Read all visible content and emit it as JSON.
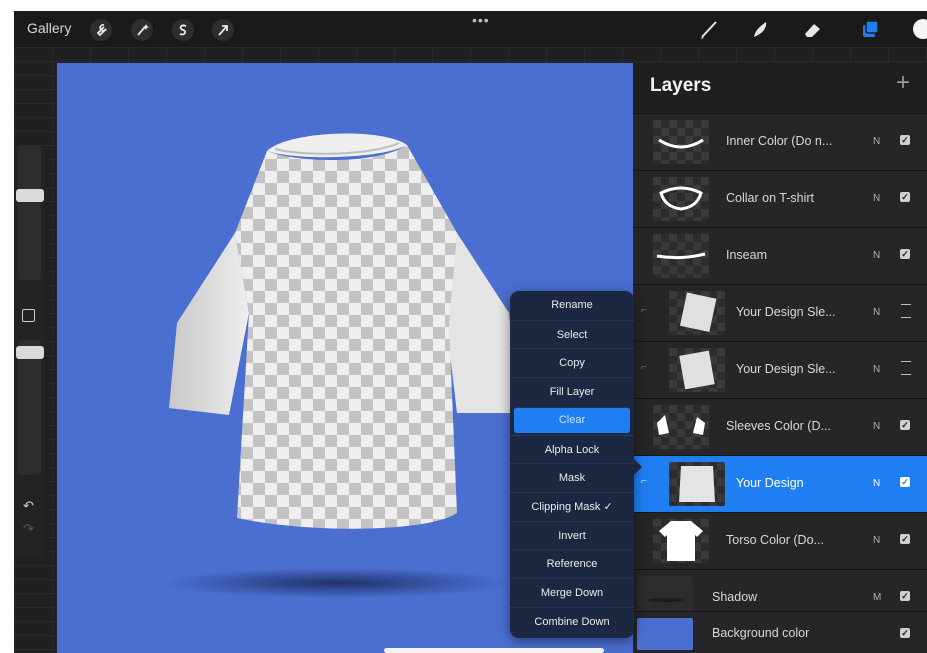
{
  "topbar": {
    "gallery_label": "Gallery",
    "more_label": "•••"
  },
  "colors": {
    "canvas_bg": "#4a6fd1",
    "accent": "#1f7ff2",
    "panel_bg": "#1f1f21"
  },
  "layers_panel": {
    "title": "Layers",
    "add_label": "+",
    "layers": [
      {
        "name": "Inner Color (Do n...",
        "mode": "N",
        "visible": true
      },
      {
        "name": "Collar on T-shirt",
        "mode": "N",
        "visible": true
      },
      {
        "name": "Inseam",
        "mode": "N",
        "visible": true
      },
      {
        "name": "Your Design Sle...",
        "mode": "N",
        "visible": true
      },
      {
        "name": "Your Design Sle...",
        "mode": "N",
        "visible": true
      },
      {
        "name": "Sleeves Color (D...",
        "mode": "N",
        "visible": true
      },
      {
        "name": "Your Design",
        "mode": "N",
        "visible": true,
        "selected": true
      },
      {
        "name": "Torso Color (Do...",
        "mode": "N",
        "visible": true
      },
      {
        "name": "Shadow",
        "mode": "M",
        "visible": true
      },
      {
        "name": "Background color",
        "mode": "",
        "visible": true
      }
    ]
  },
  "context_menu": {
    "items": [
      "Rename",
      "Select",
      "Copy",
      "Fill Layer",
      "Clear",
      "Alpha Lock",
      "Mask",
      "Clipping Mask ✓",
      "Invert",
      "Reference",
      "Merge Down",
      "Combine Down"
    ],
    "highlighted": "Clear"
  },
  "check_glyph": "✓",
  "sidebar": {
    "undo_icon": "↶",
    "redo_icon": "↷"
  }
}
